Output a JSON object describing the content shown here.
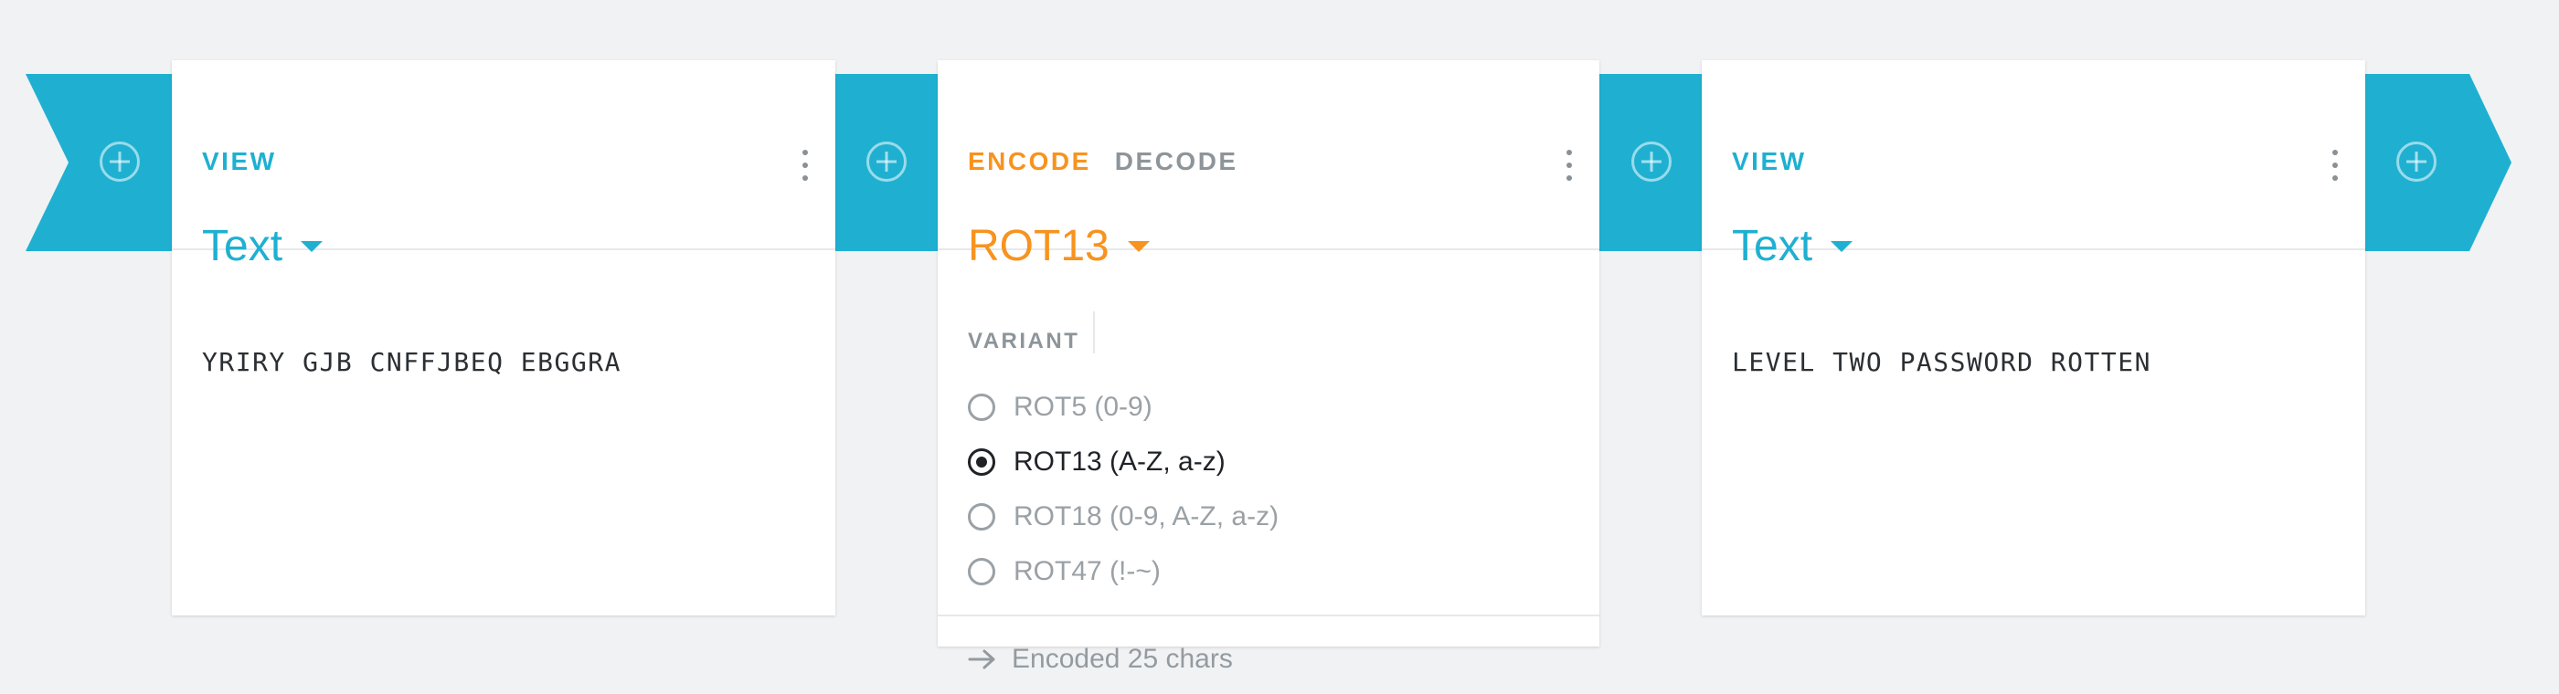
{
  "colors": {
    "accent": "#1fb0d1",
    "encode_accent": "#f7931e",
    "inactive_tab": "#8d959a"
  },
  "cards": [
    {
      "tab": "VIEW",
      "format": "Text",
      "content": "YRIRY GJB CNFFJBEQ EBGGRA"
    },
    {
      "tabs": [
        "ENCODE",
        "DECODE"
      ],
      "active_tab": "ENCODE",
      "cipher": "ROT13",
      "variant_label": "VARIANT",
      "variants": [
        {
          "label": "ROT5 (0-9)",
          "selected": false
        },
        {
          "label": "ROT13 (A-Z, a-z)",
          "selected": true
        },
        {
          "label": "ROT18 (0-9, A-Z, a-z)",
          "selected": false
        },
        {
          "label": "ROT47 (!-~)",
          "selected": false
        }
      ],
      "status": "Encoded 25 chars",
      "status_icon": "arrow-right-icon"
    },
    {
      "tab": "VIEW",
      "format": "Text",
      "content": "LEVEL TWO PASSWORD ROTTEN"
    }
  ],
  "icons": {
    "menu": "more-vert-icon",
    "add": "add-circle-icon",
    "caret": "caret-down-icon"
  }
}
